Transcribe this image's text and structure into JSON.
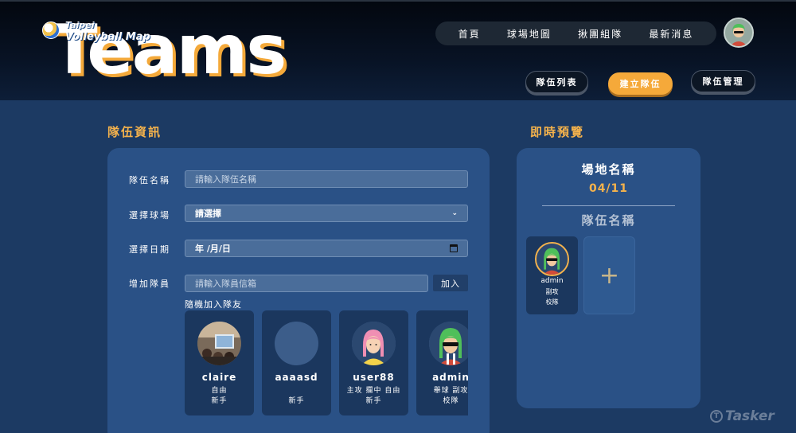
{
  "header": {
    "logo_line1": "Taipei",
    "logo_line2": "Volleyball Map",
    "big_title": "Teams",
    "nav": [
      {
        "label": "首頁"
      },
      {
        "label": "球場地圖"
      },
      {
        "label": "揪團組隊"
      },
      {
        "label": "最新消息"
      }
    ],
    "buttons": {
      "team_list": "隊伍列表",
      "create_team": "建立隊伍",
      "team_manage": "隊伍管理"
    }
  },
  "form": {
    "heading": "隊伍資訊",
    "team_name_label": "隊伍名稱",
    "team_name_placeholder": "請輸入隊伍名稱",
    "court_label": "選擇球場",
    "court_value": "請選擇",
    "date_label": "選擇日期",
    "date_value": "年 /月/日",
    "member_label": "增加隊員",
    "member_placeholder": "請輸入隊員信箱",
    "add_button": "加入",
    "random_label": "隨機加入隊友",
    "members": [
      {
        "name": "claire",
        "position": "自由",
        "level": "新手",
        "avatar": "photo-avatar"
      },
      {
        "name": "aaaasd",
        "position": "",
        "level": "新手",
        "avatar": "default-avatar"
      },
      {
        "name": "user88",
        "position": "主攻 攔中 自由",
        "level": "新手",
        "avatar": "pink-hair-avatar"
      },
      {
        "name": "admin",
        "position": "舉球 副攻",
        "level": "校隊",
        "avatar": "green-hair-avatar"
      }
    ]
  },
  "preview": {
    "heading": "即時預覽",
    "court_name": "場地名稱",
    "date": "04/11",
    "team_name": "隊伍名稱",
    "member": {
      "name": "admin",
      "position": "副攻",
      "level": "校隊"
    },
    "add_symbol": "+"
  },
  "watermark": "Tasker",
  "colors": {
    "accent_orange": "#f4b24c",
    "panel_blue": "#2a5186",
    "card_blue": "#1b375e",
    "background": "#1c3a63"
  }
}
